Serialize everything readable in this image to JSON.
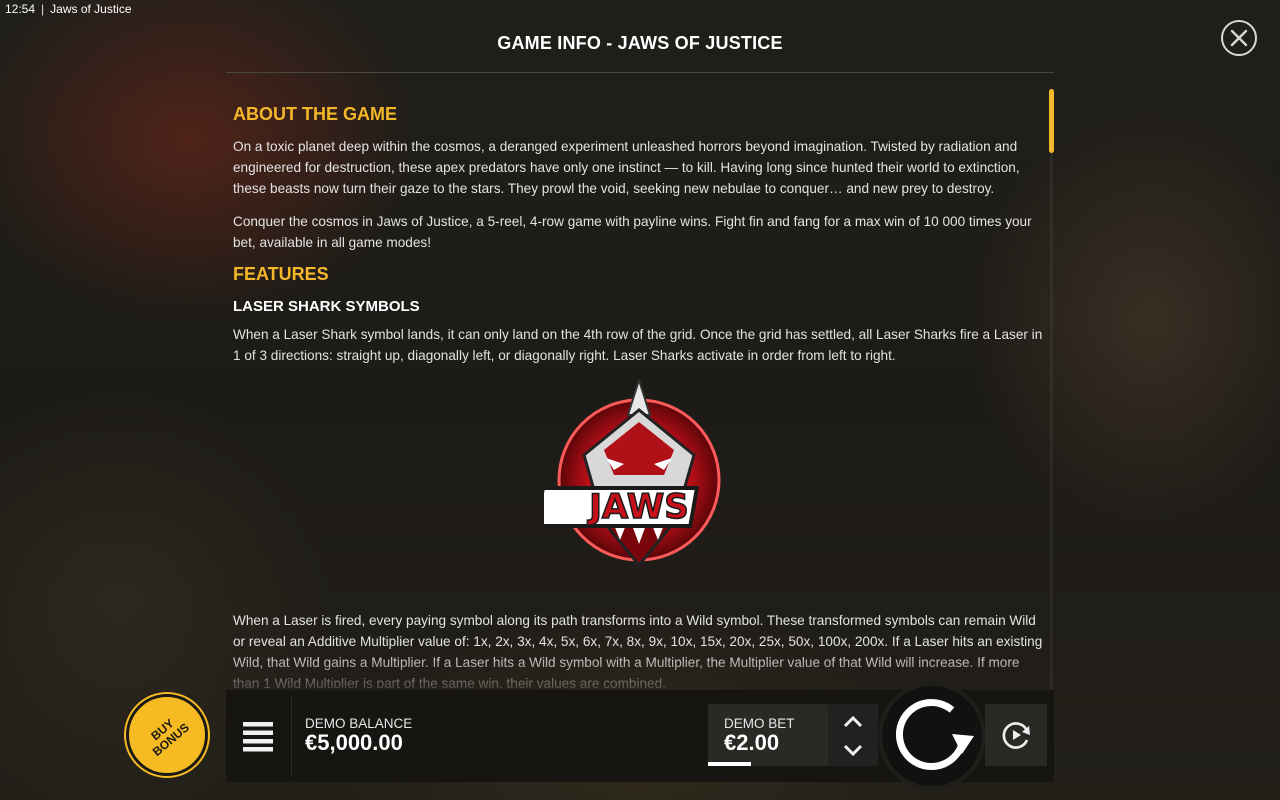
{
  "status_bar": {
    "time": "12:54",
    "separator": "|",
    "app_title": "Jaws of Justice"
  },
  "panel": {
    "title": "GAME INFO - JAWS OF JUSTICE",
    "close_icon": "close-icon"
  },
  "about": {
    "heading": "ABOUT THE GAME",
    "p1": "On a toxic planet deep within the cosmos, a deranged experiment unleashed horrors beyond imagination. Twisted by radiation and engineered for destruction, these apex predators have only one instinct — to kill. Having long since hunted their world to extinction, these beasts now turn their gaze to the stars. They prowl the void, seeking new nebulae to conquer… and new prey to destroy.",
    "p2": "Conquer the cosmos in Jaws of Justice, a 5-reel, 4-row game with payline wins. Fight fin and fang for a max win of 10 000 times your bet, available in all game modes!"
  },
  "features": {
    "heading": "FEATURES",
    "laser": {
      "heading": "LASER SHARK SYMBOLS",
      "p1": "When a Laser Shark symbol lands, it can only land on the 4th row of the grid. Once the grid has settled, all Laser Sharks fire a Laser in 1 of 3 directions: straight up, diagonally left, or diagonally right. Laser Sharks activate in order from left to right.",
      "symbol_text": "JAWS",
      "p2": "When a Laser is fired, every paying symbol along its path transforms into a Wild symbol. These transformed symbols can remain Wild or reveal an Additive Multiplier value of: 1x, 2x, 3x, 4x, 5x, 6x, 7x, 8x, 9x, 10x, 15x, 20x, 25x, 50x, 100x, 200x. If a Laser hits an existing Wild, that Wild gains a Multiplier. If a Laser hits a Wild symbol with a Multiplier, the Multiplier value of that Wild will increase. If more than 1 Wild Multiplier is part of the same win, their values are combined."
    }
  },
  "bottom_bar": {
    "buy_bonus_label": "BUY BONUS",
    "balance_label": "DEMO BALANCE",
    "balance_value": "€5,000.00",
    "bet_label": "DEMO BET",
    "bet_value": "€2.00",
    "bet_level_fraction": 0.36
  },
  "colors": {
    "accent": "#f5b72a",
    "panel_bg": "#1b1915",
    "symbol_red": "#d4121a"
  }
}
